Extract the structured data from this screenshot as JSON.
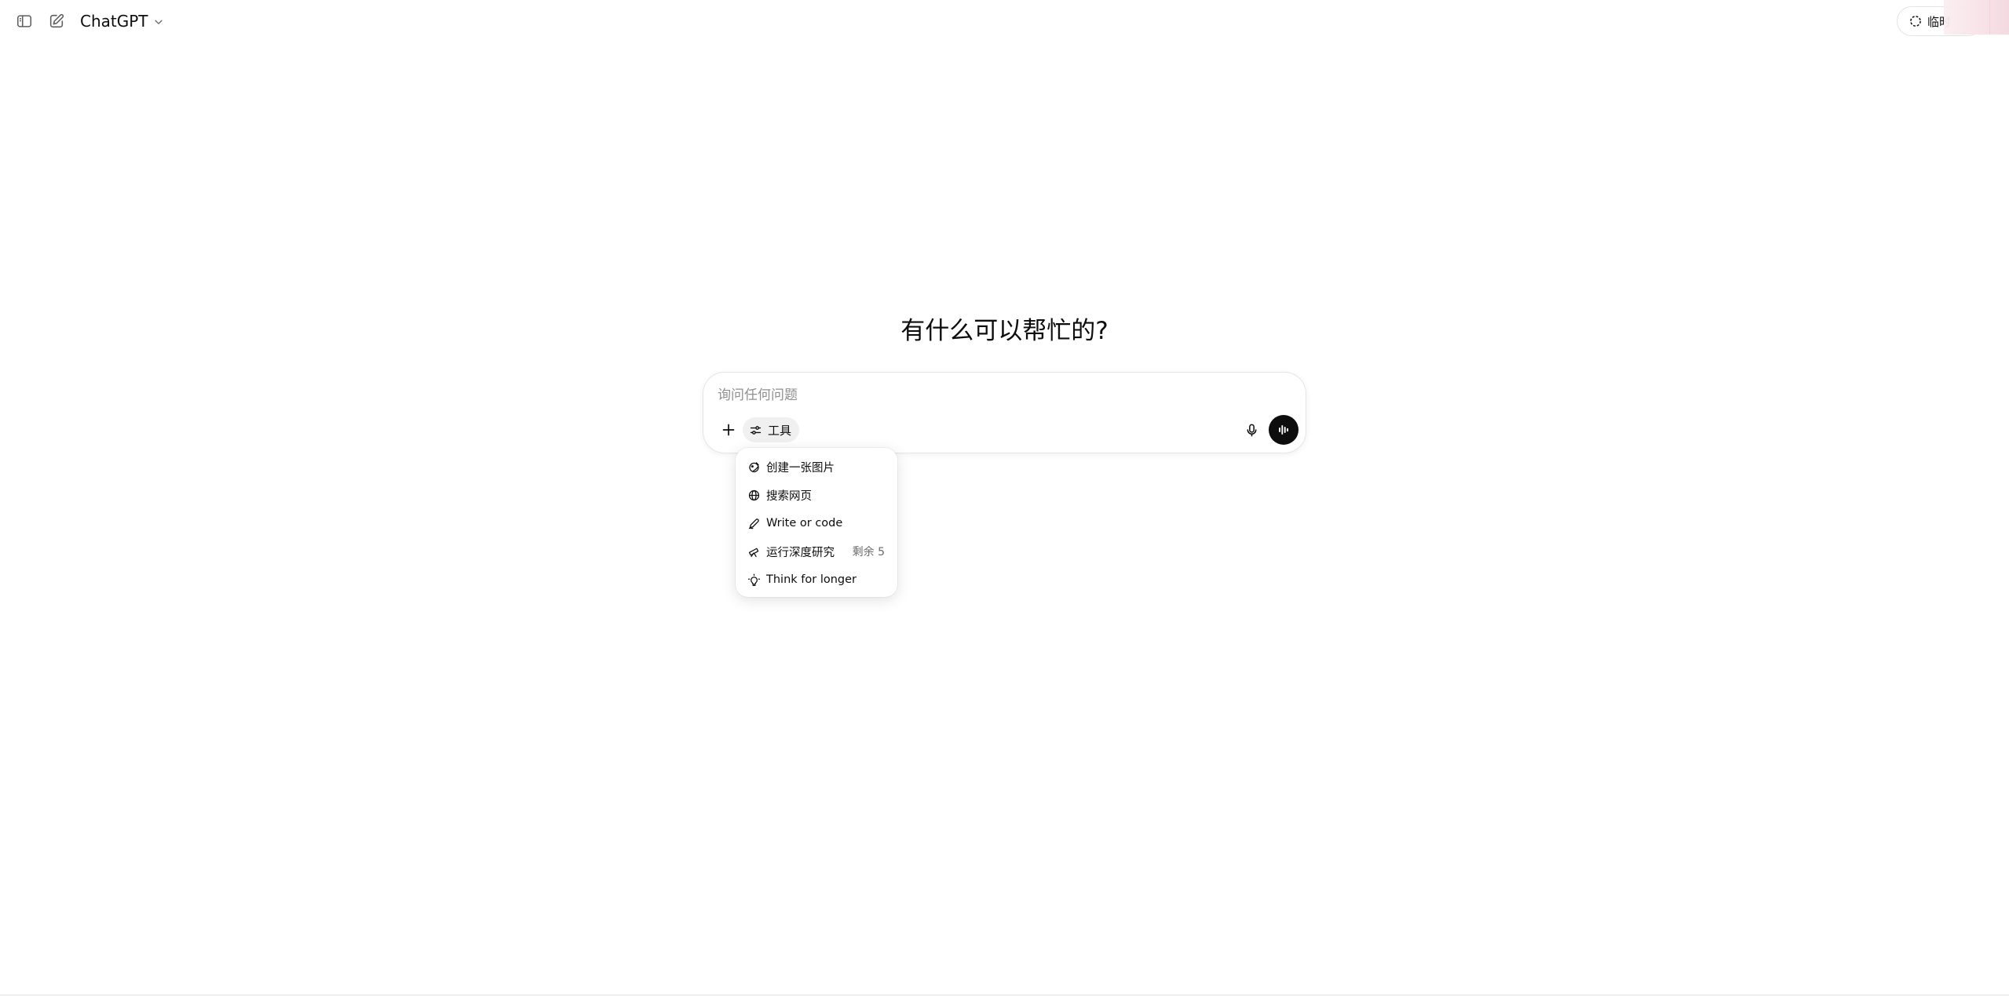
{
  "header": {
    "sidebar_icon": "sidebar-toggle-icon",
    "new_chat_icon": "compose-icon",
    "model_name": "ChatGPT",
    "temp_chat_label": "临时"
  },
  "main": {
    "heading": "有什么可以帮忙的?",
    "composer": {
      "placeholder": "询问任何问题",
      "value": "",
      "tools_label": "工具"
    }
  },
  "tools_menu": {
    "items": [
      {
        "label": "创建一张图片",
        "icon": "image-create-icon",
        "badge": ""
      },
      {
        "label": "搜索网页",
        "icon": "globe-icon",
        "badge": ""
      },
      {
        "label": "Write or code",
        "icon": "pen-icon",
        "badge": ""
      },
      {
        "label": "运行深度研究",
        "icon": "telescope-icon",
        "badge": "剩余 5"
      },
      {
        "label": "Think for longer",
        "icon": "lightbulb-icon",
        "badge": ""
      }
    ]
  },
  "colors": {
    "text": "#0d0d0d",
    "muted": "#8f8f8f",
    "voice_button_bg": "#0d0d0d",
    "tools_chip_bg": "#f0f0f0"
  }
}
